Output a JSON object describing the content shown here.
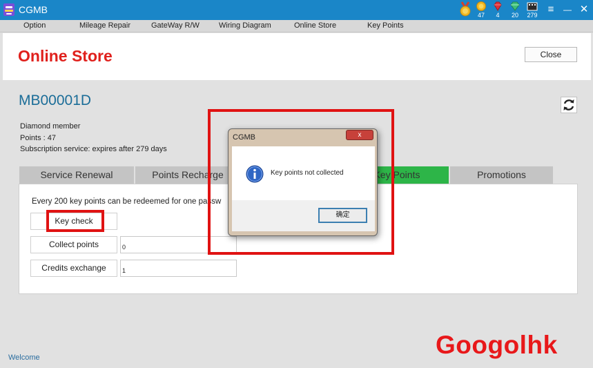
{
  "window": {
    "title": "CGMB",
    "colors": {
      "titlebar": "#1a86c8",
      "accent_red": "#e0201c",
      "active_tab": "#2db548"
    },
    "stats": [
      {
        "icon": "gold-medal-icon",
        "value": ""
      },
      {
        "icon": "gold-coin-icon",
        "value": "47"
      },
      {
        "icon": "red-gem-icon",
        "value": "4"
      },
      {
        "icon": "green-diamond-icon",
        "value": "20"
      },
      {
        "icon": "calendar-icon",
        "value": "279"
      }
    ],
    "controls": {
      "menu": "≡",
      "minimize": "—",
      "close": "✕"
    }
  },
  "menu": [
    "Option",
    "Mileage Repair",
    "GateWay R/W",
    "Wiring Diagram",
    "Online Store",
    "Key Points"
  ],
  "header": {
    "title": "Online Store",
    "close_label": "Close"
  },
  "account": {
    "id": "MB00001D",
    "membership": "Diamond member",
    "points": "Points : 47",
    "subscription": "Subscription service: expires after 279 days"
  },
  "tabs": [
    {
      "label": "Service Renewal",
      "active": false
    },
    {
      "label": "Points Recharge",
      "active": false
    },
    {
      "label": "Key Points",
      "active": true
    },
    {
      "label": "Promotions",
      "active": false
    }
  ],
  "key_points_panel": {
    "description": "Every 200 key points can be redeemed for one passw",
    "key_check_label": "Key check",
    "collect_points_label": "Collect points",
    "collect_points_value": "0",
    "credits_exchange_label": "Credits exchange",
    "credits_exchange_value": "1"
  },
  "dialog": {
    "title": "CGMB",
    "close_symbol": "x",
    "icon": "info-icon",
    "message": "Key points not collected",
    "ok_label": "确定"
  },
  "status": {
    "text": "Welcome"
  },
  "watermark": {
    "text": "Googolhk"
  }
}
